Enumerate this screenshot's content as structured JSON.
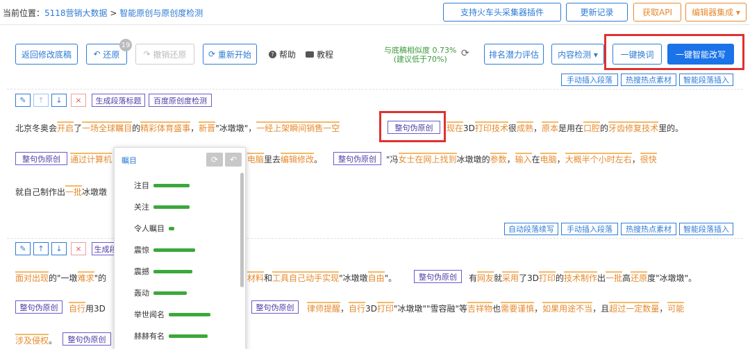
{
  "breadcrumb": {
    "prefix": "当前位置：",
    "item1": "5118营销大数据",
    "sep": " > ",
    "item2": "智能原创与原创度检测"
  },
  "topbar": {
    "plugin_btn": "支持火车头采集器插件",
    "log_btn": "更新记录",
    "api_btn": "获取API",
    "editor_btn": "编辑器集成 ▾"
  },
  "toolbar": {
    "back_btn": "返回修改底稿",
    "undo_btn": "还原",
    "undo_count": "19",
    "redo_btn": "撤销还原",
    "restart_btn": "重新开始",
    "help": "帮助",
    "tutorial": "教程",
    "similarity_line1": "与底稿相似度 0.73%",
    "similarity_line2": "(建议低于70%)",
    "rank_btn": "排名潜力评估",
    "content_btn": "内容检测 ▾",
    "replace_btn": "一键换词",
    "rewrite_btn": "一键智能改写"
  },
  "section1_tools": {
    "manual_insert": "手动插入段落",
    "hot_material": "热搜热点素材",
    "smart_insert": "智能段落插入"
  },
  "para_tools": {
    "gen_title": "生成段落标题",
    "baidu_check": "百度原创度检测"
  },
  "sentence_btn": "整句伪原创",
  "para1": {
    "t1": "北京冬奥会",
    "w1": "开启",
    "t2": "了",
    "w2": "一场",
    "w3": "全球",
    "w4": "瞩目",
    "t3": "的",
    "w5": "精彩",
    "w6": "体育",
    "w7": "盛事",
    "t4": "，",
    "w8": "新晋",
    "t5": "\"冰墩墩\"，",
    "w9": "一经",
    "w10": "上架",
    "w11": "瞬间",
    "w12": "销售",
    "w13": "一空",
    "w14": "现在",
    "t6": "3D",
    "w15": "打印",
    "w16": "技术",
    "t7": "很",
    "w17": "成熟",
    "t8": "，",
    "w18": "原本",
    "t9": "是用在",
    "w19": "口腔",
    "t10": "的",
    "w20": "牙齿",
    "w21": "修复",
    "w22": "技术",
    "t11": "里的。"
  },
  "para2": {
    "w1": "通过",
    "w2": "计算机",
    "w3": "电脑",
    "t1": "里去",
    "w4": "编辑",
    "w5": "修改",
    "t2": "。",
    "t3": "\"冯",
    "w6": "女士",
    "w7": "在网上",
    "w8": "找到",
    "t4": "冰墩墩的",
    "w9": "参数",
    "t5": "，",
    "w10": "输入",
    "t6": "在",
    "w11": "电脑",
    "t7": "，",
    "w12": "大概",
    "w13": "半个",
    "w14": "小时",
    "w15": "左右",
    "t8": "，",
    "w16": "很快"
  },
  "para3": {
    "t1": "就自己制作出",
    "w1": "一批",
    "t2": "冰墩墩"
  },
  "section2_tools": {
    "auto_continue": "自动段落续写",
    "manual_insert": "手动插入段落",
    "hot_material": "热搜热点素材",
    "smart_insert": "智能段落插入"
  },
  "section2_gen": "生成段",
  "para4": {
    "w1": "面对",
    "w2": "出现",
    "t1": "的\"一墩",
    "w3": "难求",
    "t2": "\"的",
    "w4": "材料",
    "t3": "和",
    "w5": "工具",
    "w6": "自己",
    "w7": "动手",
    "w8": "实现",
    "t4": "\"冰墩墩",
    "w9": "自由",
    "t5": "\"。",
    "t6": "有",
    "w10": "网友",
    "t7": "就",
    "w11": "采用",
    "t8": "了3D",
    "w12": "打印",
    "t9": "的",
    "w13": "技术",
    "w14": "制作",
    "t10": "出",
    "w15": "一批",
    "t11": "高",
    "w16": "还原",
    "t12": "度\"冰墩墩\"。"
  },
  "para5": {
    "w1": "自行",
    "t1": "用3D",
    "w2": "律师",
    "w3": "提醒",
    "t2": "，",
    "w4": "自行",
    "t3": "3D",
    "w5": "打印",
    "t4": "\"冰墩墩\"\"雪容融\"等",
    "w6": "吉祥物",
    "t5": "也",
    "w7": "需要",
    "w8": "谨慎",
    "t6": "，",
    "w9": "如果",
    "w10": "用途",
    "w11": "不当",
    "t7": "，且",
    "w12": "超过",
    "w13": "一定",
    "w14": "数量",
    "t8": "，",
    "w15": "可能"
  },
  "para6": {
    "w1": "涉及",
    "w2": "侵权",
    "t1": "。"
  },
  "dropdown": {
    "title": "瞩目",
    "items": [
      {
        "label": "注目",
        "score": 0.65
      },
      {
        "label": "关注",
        "score": 0.65
      },
      {
        "label": "令人瞩目",
        "score": 0.1
      },
      {
        "label": "震惊",
        "score": 0.75
      },
      {
        "label": "震撼",
        "score": 0.7
      },
      {
        "label": "轰动",
        "score": 0.6
      },
      {
        "label": "举世闻名",
        "score": 0.75
      },
      {
        "label": "赫赫有名",
        "score": 0.7
      }
    ]
  }
}
